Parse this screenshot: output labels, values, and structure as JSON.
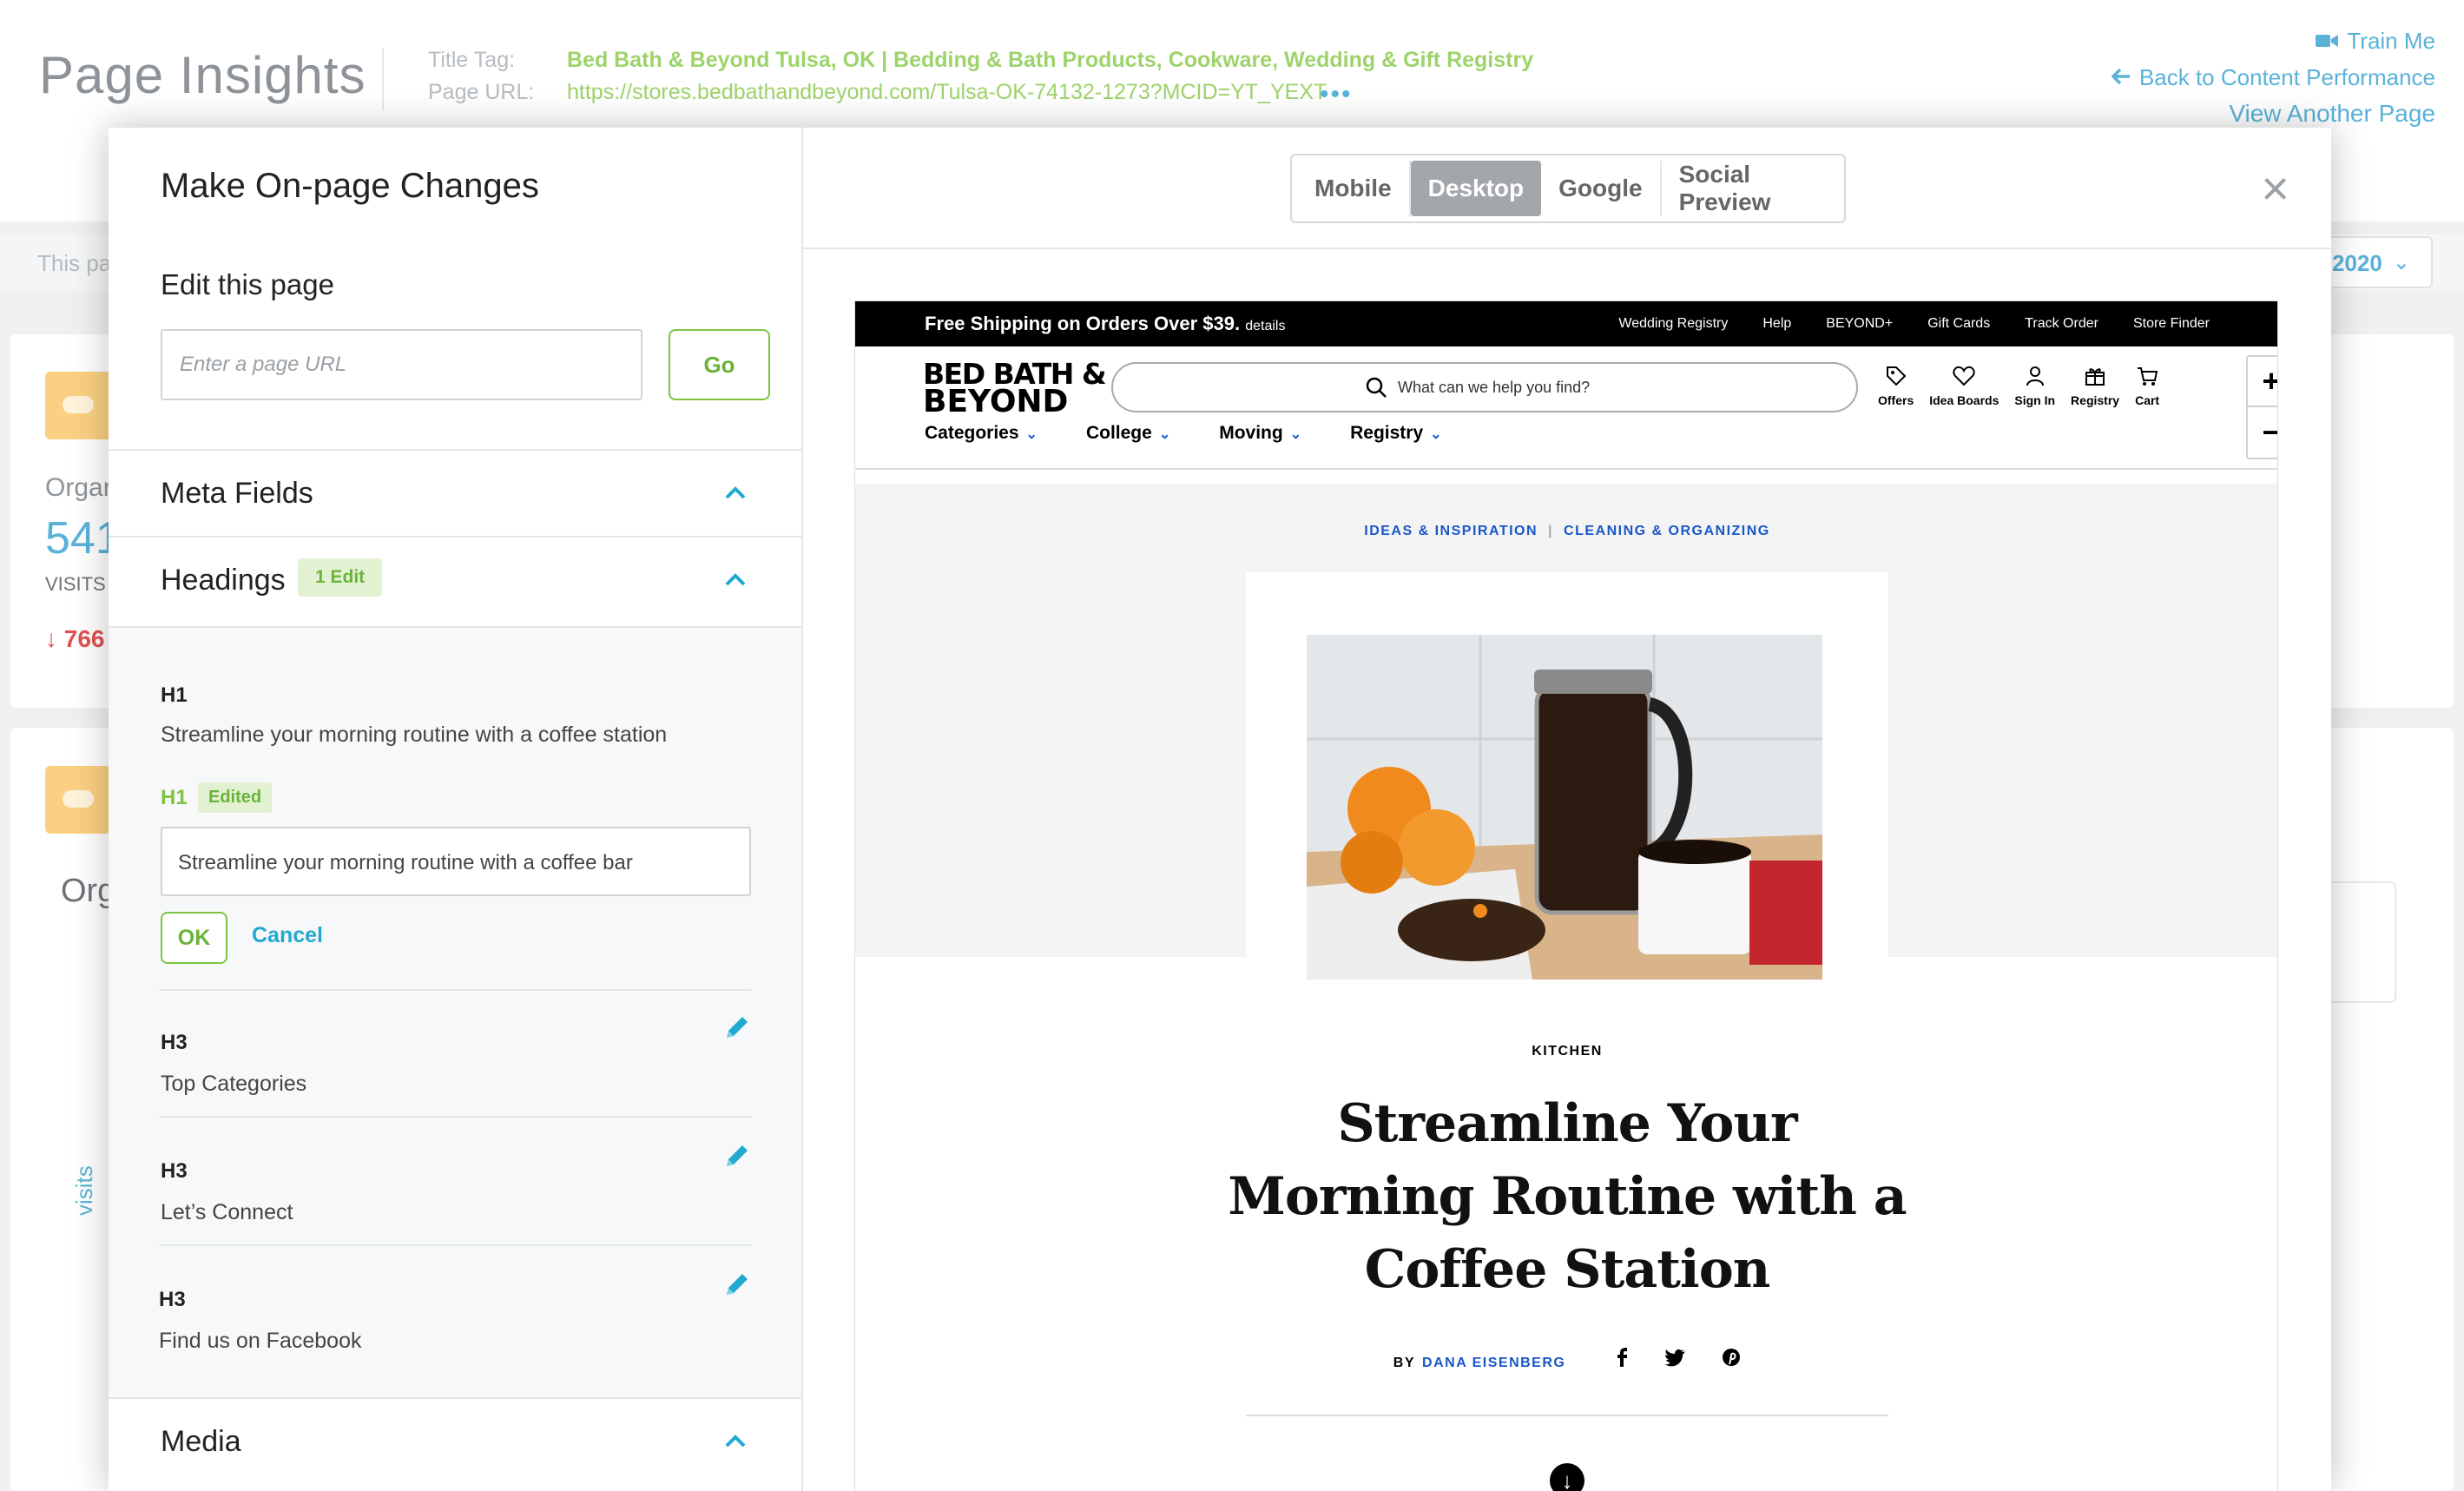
{
  "header": {
    "page_title": "Page Insights",
    "title_tag_label": "Title Tag:",
    "title_tag_value": "Bed Bath & Beyond Tulsa, OK | Bedding & Bath Products, Cookware, Wedding & Gift Registry",
    "page_url_label": "Page URL:",
    "page_url_value": "https://stores.bedbathandbeyond.com/Tulsa-OK-74132-1273?MCID=YT_YEXT",
    "more_dots": "•••",
    "train_me": "Train Me",
    "back_link": "Back to Content Performance",
    "view_another": "View Another Page"
  },
  "background": {
    "strip_text": "This pa",
    "date_value": "2020",
    "card1_label": "Orgar",
    "card1_value": "541",
    "card1_unit": "VISITS",
    "card1_change": "766",
    "card2_label": "Org",
    "axis_label": "visits"
  },
  "panel": {
    "title": "Make On-page Changes",
    "edit_label": "Edit this page",
    "url_placeholder": "Enter a page URL",
    "go_label": "Go",
    "meta_fields": "Meta Fields",
    "headings": "Headings",
    "headings_badge": "1 Edit",
    "media": "Media",
    "items": [
      {
        "tag": "H1",
        "text": "Streamline your morning routine with a coffee station"
      },
      {
        "tag": "H3",
        "text": "Top Categories"
      },
      {
        "tag": "H3",
        "text": "Let’s Connect"
      },
      {
        "tag": "H3",
        "text": "Find us on Facebook"
      }
    ],
    "edit_tag": "H1",
    "edited_badge": "Edited",
    "edit_value": "Streamline your morning routine with a coffee bar",
    "ok_label": "OK",
    "cancel_label": "Cancel"
  },
  "viewer": {
    "tabs": [
      "Mobile",
      "Desktop",
      "Google",
      "Social Preview"
    ],
    "active_tab": "Desktop",
    "close": "×"
  },
  "preview": {
    "shipping": "Free Shipping on Orders Over $39.",
    "shipping_details": "details",
    "utils": [
      "Wedding Registry",
      "Help",
      "BEYOND+",
      "Gift Cards",
      "Track Order",
      "Store Finder"
    ],
    "logo_line1": "BED BATH &",
    "logo_line2": "BEYOND",
    "search_placeholder": "What can we help you find?",
    "icons": [
      "Offers",
      "Idea Boards",
      "Sign In",
      "Registry",
      "Cart"
    ],
    "nav": [
      "Categories",
      "College",
      "Moving",
      "Registry"
    ],
    "zoom_in": "+",
    "zoom_out": "−",
    "crumb1": "IDEAS & INSPIRATION",
    "crumb2": "CLEANING & ORGANIZING",
    "kicker": "KITCHEN",
    "article_title": "Streamline Your Morning Routine with a Coffee Station",
    "by": "BY",
    "author": "DANA EISENBERG"
  },
  "colors": {
    "accent_green": "#7cc443",
    "accent_blue": "#22a9cf",
    "link_blue": "#5ab2d8",
    "bbb_blue": "#1a56c9"
  }
}
